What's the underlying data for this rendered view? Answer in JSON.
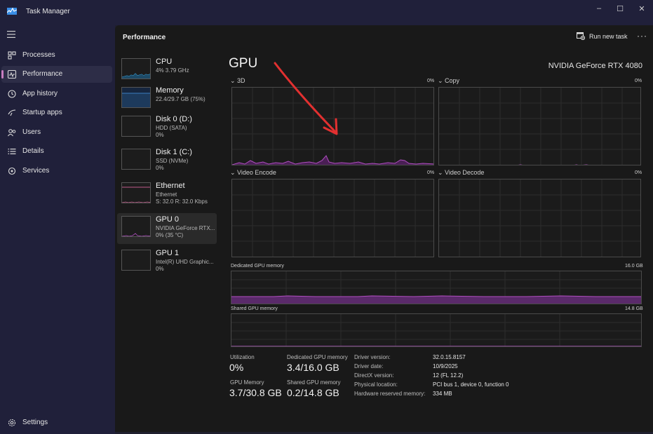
{
  "window": {
    "title": "Task Manager",
    "controls": {
      "minimize": "–",
      "maximize": "☐",
      "close": "✕"
    }
  },
  "nav": {
    "items": [
      {
        "label": "Processes",
        "icon": "processes-icon"
      },
      {
        "label": "Performance",
        "icon": "performance-icon",
        "active": true
      },
      {
        "label": "App history",
        "icon": "history-icon"
      },
      {
        "label": "Startup apps",
        "icon": "startup-icon"
      },
      {
        "label": "Users",
        "icon": "users-icon"
      },
      {
        "label": "Details",
        "icon": "details-icon"
      },
      {
        "label": "Services",
        "icon": "services-icon"
      }
    ],
    "settings_label": "Settings"
  },
  "header": {
    "title": "Performance",
    "run_task_label": "Run new task",
    "more_label": "···"
  },
  "devices": [
    {
      "name": "CPU",
      "sub1": "4% 3.79 GHz",
      "sub2": "",
      "sub3": ""
    },
    {
      "name": "Memory",
      "sub1": "22.4/29.7 GB (75%)",
      "sub2": "",
      "sub3": ""
    },
    {
      "name": "Disk 0 (D:)",
      "sub1": "HDD (SATA)",
      "sub2": "0%",
      "sub3": ""
    },
    {
      "name": "Disk 1 (C:)",
      "sub1": "SSD (NVMe)",
      "sub2": "0%",
      "sub3": ""
    },
    {
      "name": "Ethernet",
      "sub1": "Ethernet",
      "sub2": "S: 32.0 R: 32.0 Kbps",
      "sub3": ""
    },
    {
      "name": "GPU 0",
      "sub1": "NVIDIA GeForce RTX...",
      "sub2": "0% (35 °C)",
      "sub3": ""
    },
    {
      "name": "GPU 1",
      "sub1": "Intel(R) UHD Graphic...",
      "sub2": "0%",
      "sub3": ""
    }
  ],
  "gpu": {
    "title": "GPU",
    "model": "NVIDIA GeForce RTX 4080",
    "engines": [
      {
        "label": "3D",
        "pct": "0%"
      },
      {
        "label": "Copy",
        "pct": "0%"
      },
      {
        "label": "Video Encode",
        "pct": "0%"
      },
      {
        "label": "Video Decode",
        "pct": "0%"
      }
    ],
    "dedicated": {
      "label": "Dedicated GPU memory",
      "max": "16.0 GB"
    },
    "shared": {
      "label": "Shared GPU memory",
      "max": "14.8 GB"
    }
  },
  "stats": {
    "utilization_label": "Utilization",
    "utilization_value": "0%",
    "dedicated_label": "Dedicated GPU memory",
    "dedicated_value": "3.4/16.0 GB",
    "gpu_memory_label": "GPU Memory",
    "gpu_memory_value": "3.7/30.8 GB",
    "shared_label": "Shared GPU memory",
    "shared_value": "0.2/14.8 GB"
  },
  "details": [
    {
      "label": "Driver version:",
      "value": "32.0.15.8157"
    },
    {
      "label": "Driver date:",
      "value": "10/9/2025"
    },
    {
      "label": "DirectX version:",
      "value": "12 (FL 12.2)"
    },
    {
      "label": "Physical location:",
      "value": "PCI bus 1, device 0, function 0"
    },
    {
      "label": "Hardware reserved memory:",
      "value": "334 MB"
    }
  ],
  "colors": {
    "accent": "#c77dbf",
    "graph_line": "#b04fc0",
    "memory_fill": "#5a2a6a",
    "annotation_arrow": "#e23030"
  }
}
